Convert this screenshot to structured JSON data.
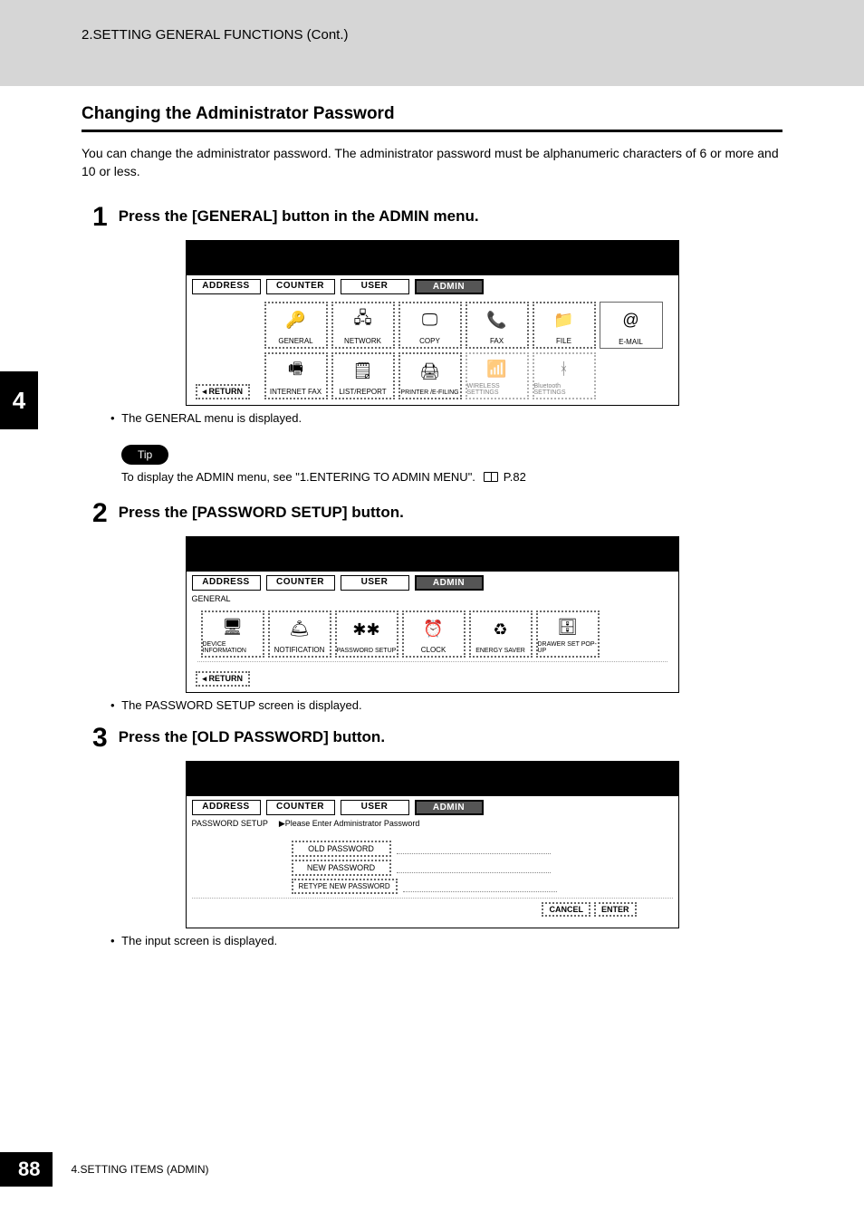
{
  "header": {
    "running_title": "2.SETTING GENERAL FUNCTIONS (Cont.)"
  },
  "section": {
    "title": "Changing the Administrator Password",
    "intro": "You can change the administrator password.  The administrator password must be alphanumeric characters of 6 or more and 10 or less."
  },
  "steps": {
    "s1": {
      "num": "1",
      "text": "Press the [GENERAL] button in the ADMIN menu.",
      "note": "The GENERAL menu is displayed."
    },
    "s2": {
      "num": "2",
      "text": "Press the [PASSWORD SETUP] button.",
      "note": "The PASSWORD SETUP screen is displayed."
    },
    "s3": {
      "num": "3",
      "text": "Press the [OLD PASSWORD] button.",
      "note": "The input screen is displayed."
    }
  },
  "tip": {
    "label": "Tip",
    "text_before": "To display the ADMIN menu, see \"1.ENTERING TO ADMIN MENU\".",
    "page_ref": "P.82"
  },
  "screens": {
    "tabs": {
      "address": "ADDRESS",
      "counter": "COUNTER",
      "user": "USER",
      "admin": "ADMIN"
    },
    "return_label": "RETURN",
    "admin_menu": {
      "row1": [
        "GENERAL",
        "NETWORK",
        "COPY",
        "FAX",
        "FILE",
        "E-MAIL"
      ],
      "row2": [
        "INTERNET FAX",
        "LIST/REPORT",
        "PRINTER /E-FILING",
        "WIRELESS SETTINGS",
        "Bluetooth SETTINGS"
      ]
    },
    "general_menu": {
      "label": "GENERAL",
      "items": [
        "DEVICE INFORMATION",
        "NOTIFICATION",
        "PASSWORD SETUP",
        "CLOCK",
        "ENERGY SAVER",
        "DRAWER SET POP-UP"
      ]
    },
    "password_setup": {
      "label": "PASSWORD SETUP",
      "prompt": "▶Please Enter Administrator Password",
      "buttons": {
        "old": "OLD PASSWORD",
        "new": "NEW PASSWORD",
        "retype": "RETYPE NEW PASSWORD"
      },
      "footer": {
        "cancel": "CANCEL",
        "enter": "ENTER"
      }
    }
  },
  "side_tab": "4",
  "footer": {
    "page_number": "88",
    "chapter": "4.SETTING ITEMS (ADMIN)"
  }
}
